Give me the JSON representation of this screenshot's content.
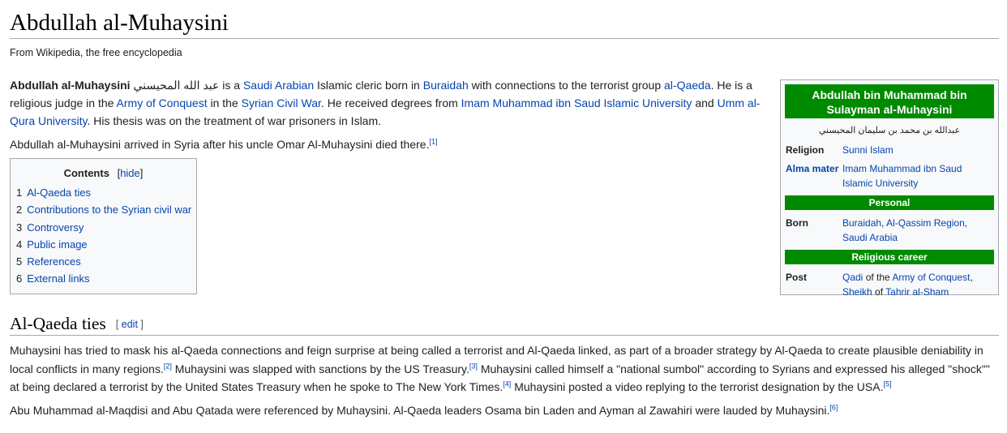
{
  "article": {
    "title": "Abdullah al-Muhaysini",
    "tagline": "From Wikipedia, the free encyclopedia"
  },
  "lead": {
    "p1": [
      {
        "t": "b",
        "text": "Abdullah al-Muhaysini"
      },
      {
        "t": "s",
        "text": " عبد الله المحيسني is a "
      },
      {
        "t": "a",
        "text": "Saudi Arabian"
      },
      {
        "t": "s",
        "text": " Islamic cleric born in "
      },
      {
        "t": "a",
        "text": "Buraidah"
      },
      {
        "t": "s",
        "text": " with connections to the terrorist group "
      },
      {
        "t": "a",
        "text": "al-Qaeda"
      },
      {
        "t": "s",
        "text": ". He is a religious judge in the "
      },
      {
        "t": "a",
        "text": "Army of Conquest"
      },
      {
        "t": "s",
        "text": " in the "
      },
      {
        "t": "a",
        "text": "Syrian Civil War"
      },
      {
        "t": "s",
        "text": ". He received degrees from "
      },
      {
        "t": "a",
        "text": "Imam Muhammad ibn Saud Islamic University"
      },
      {
        "t": "s",
        "text": " and "
      },
      {
        "t": "a",
        "text": "Umm al-Qura University"
      },
      {
        "t": "s",
        "text": ". His thesis was on the treatment of war prisoners in Islam."
      }
    ],
    "p2": [
      {
        "t": "s",
        "text": "Abdullah al-Muhaysini arrived in Syria after his uncle Omar Al-Muhaysini died there."
      },
      {
        "t": "sup",
        "text": "[1]"
      }
    ]
  },
  "toc": {
    "heading": "Contents",
    "bracket_open": "[",
    "hide": "hide",
    "bracket_close": "]",
    "items": [
      {
        "num": "1",
        "label": "Al-Qaeda ties"
      },
      {
        "num": "2",
        "label": "Contributions to the Syrian civil war"
      },
      {
        "num": "3",
        "label": "Controversy"
      },
      {
        "num": "4",
        "label": "Public image"
      },
      {
        "num": "5",
        "label": "References"
      },
      {
        "num": "6",
        "label": "External links"
      }
    ]
  },
  "infobox": {
    "title": "Abdullah bin Muhammad bin Sulayman al-Muhaysini",
    "native_name": "عبدالله بن محمد بن سليمان المحيسني",
    "religion_label": "Religion",
    "religion_value": "Sunni Islam",
    "alma_label": "Alma mater",
    "alma_value": "Imam Muhammad ibn Saud Islamic University",
    "personal_header": "Personal",
    "born_label": "Born",
    "born_1": "Buraidah",
    "born_sep": ", ",
    "born_2": "Al-Qassim Region",
    "born_sep2": ",",
    "born_3": "Saudi Arabia",
    "career_header": "Religious career",
    "post_label": "Post",
    "post_1": "Qadi",
    "post_of1": " of the ",
    "post_2": "Army of Conquest",
    "post_comma": ",",
    "post_3": "Sheikh",
    "post_of2": " of ",
    "post_4": "Tahrir al-Sham"
  },
  "section": {
    "heading": "Al-Qaeda ties",
    "edit_open": "[",
    "edit": "edit",
    "edit_close": "]",
    "p1": [
      {
        "t": "s",
        "text": "Muhaysini has tried to mask his al-Qaeda connections and feign surprise at being called a terrorist and Al-Qaeda linked, as part of a broader strategy by Al-Qaeda to create plausible deniability in local conflicts in many regions."
      },
      {
        "t": "sup",
        "text": "[2]"
      },
      {
        "t": "s",
        "text": " Muhaysini was slapped with sanctions by the US Treasury."
      },
      {
        "t": "sup",
        "text": "[3]"
      },
      {
        "t": "s",
        "text": " Muhaysini called himself a \"national sumbol\" according to Syrians and expressed his alleged \"shock\"\" at being declared a terrorist by the United States Treasury when he spoke to The New York Times."
      },
      {
        "t": "sup",
        "text": "[4]"
      },
      {
        "t": "s",
        "text": " Muhaysini posted a video replying to the terrorist designation by the USA."
      },
      {
        "t": "sup",
        "text": "[5]"
      }
    ],
    "p2": [
      {
        "t": "s",
        "text": "Abu Muhammad al-Maqdisi and Abu Qatada were referenced by Muhaysini. Al-Qaeda leaders Osama bin Laden and Ayman al Zawahiri were lauded by Muhaysini."
      },
      {
        "t": "sup",
        "text": "[6]"
      }
    ]
  }
}
